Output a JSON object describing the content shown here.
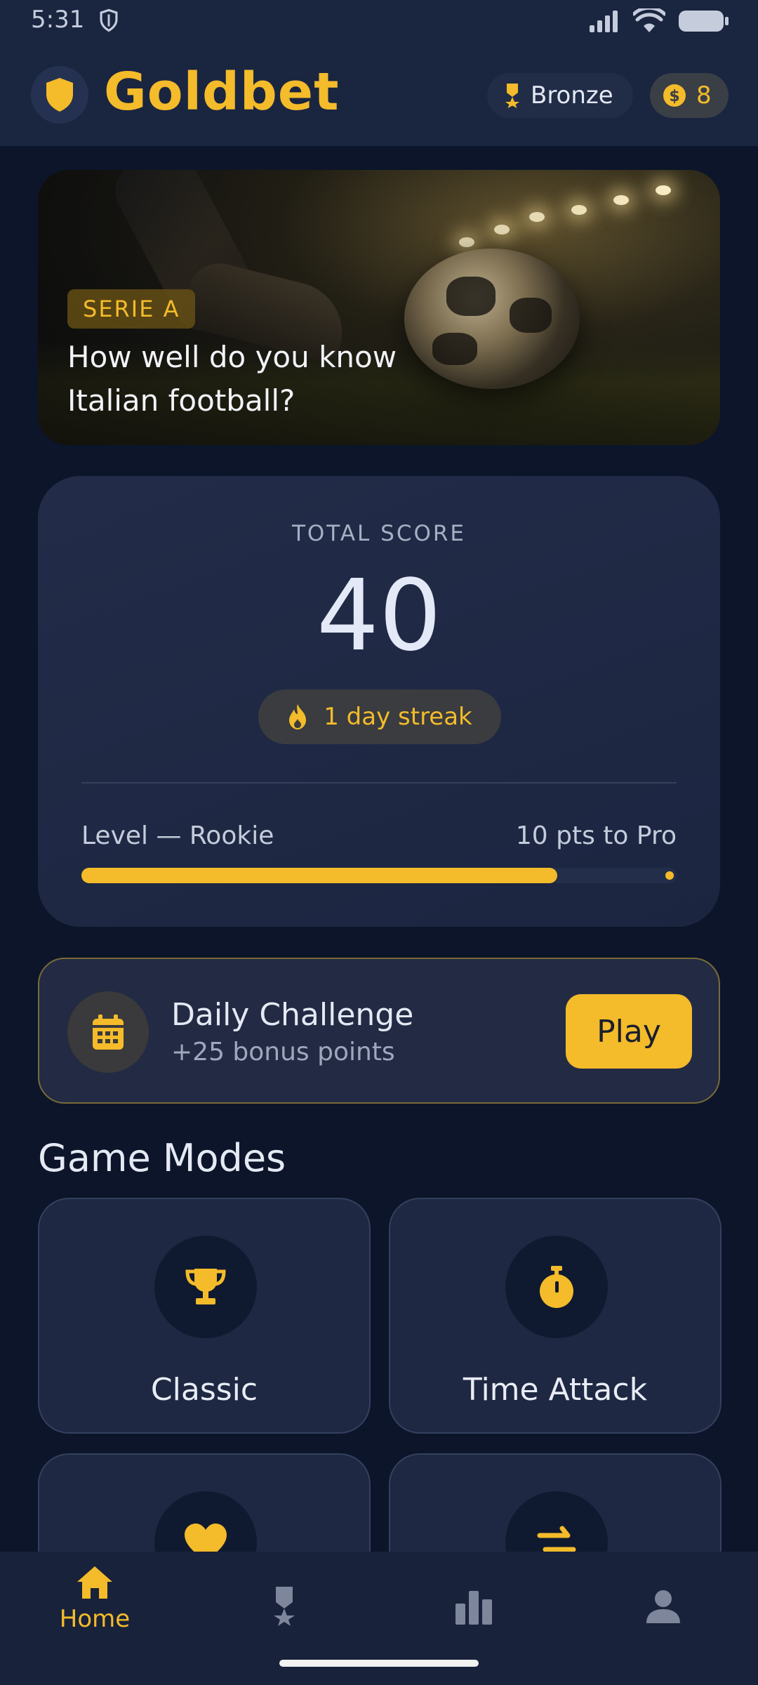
{
  "status_bar": {
    "time": "5:31"
  },
  "header": {
    "brand": "Goldbet",
    "rank_label": "Bronze",
    "coins": "8"
  },
  "hero": {
    "tag": "SERIE A",
    "title": "How well do you know Italian football?"
  },
  "score": {
    "label": "TOTAL SCORE",
    "value": "40",
    "streak": "1 day streak",
    "level_label": "Level — Rookie",
    "next_level": "10 pts to Pro",
    "progress_fraction": 0.8
  },
  "challenge": {
    "title": "Daily Challenge",
    "subtitle": "+25 bonus points",
    "play_label": "Play"
  },
  "game_modes": {
    "title": "Game Modes",
    "modes": [
      {
        "label": "Classic",
        "icon": "trophy-icon"
      },
      {
        "label": "Time Attack",
        "icon": "stopwatch-icon"
      },
      {
        "label": "",
        "icon": "heart-icon"
      },
      {
        "label": "",
        "icon": "swap-arrows-icon"
      }
    ]
  },
  "bottom_nav": {
    "items": [
      {
        "label": "Home",
        "icon": "home-icon",
        "active": true
      },
      {
        "label": "",
        "icon": "medal-icon",
        "active": false
      },
      {
        "label": "",
        "icon": "bar-chart-icon",
        "active": false
      },
      {
        "label": "",
        "icon": "person-icon",
        "active": false
      }
    ]
  },
  "colors": {
    "accent": "#f4bb2a",
    "background": "#0c1529",
    "card": "#1e2842"
  }
}
